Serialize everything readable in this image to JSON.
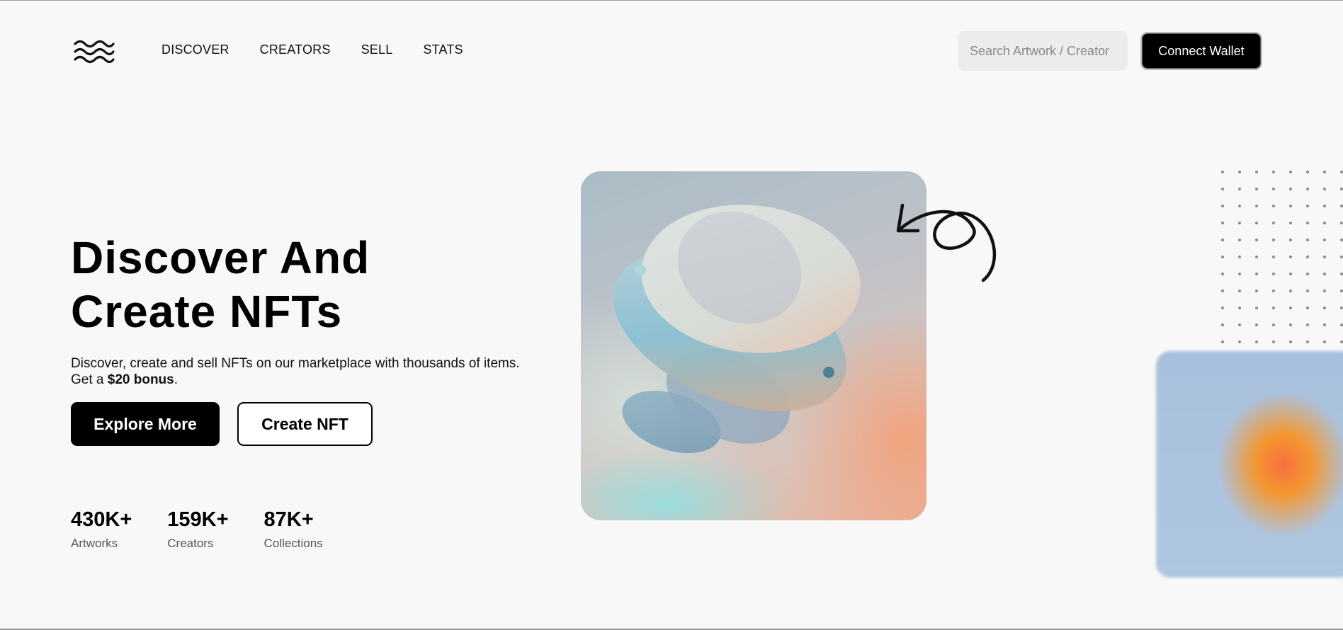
{
  "nav": {
    "items": [
      {
        "label": "DISCOVER"
      },
      {
        "label": "CREATORS"
      },
      {
        "label": "SELL"
      },
      {
        "label": "STATS"
      }
    ]
  },
  "search": {
    "placeholder": "Search Artwork / Creator"
  },
  "header": {
    "connect_label": "Connect Wallet"
  },
  "hero": {
    "title_line1": "Discover And",
    "title_line2": "Create NFTs",
    "subtitle_text": "Discover, create and sell NFTs on our marketplace with thousands of items. Get a ",
    "subtitle_bonus": "$20 bonus",
    "subtitle_end": ".",
    "explore_label": "Explore More",
    "create_label": "Create NFT"
  },
  "stats": [
    {
      "value": "430K+",
      "label": "Artworks"
    },
    {
      "value": "159K+",
      "label": "Creators"
    },
    {
      "value": "87K+",
      "label": "Collections"
    }
  ],
  "icons": {
    "logo": "waves-logo-icon",
    "arrow": "curly-arrow-icon",
    "dots": "dot-grid-pattern"
  }
}
